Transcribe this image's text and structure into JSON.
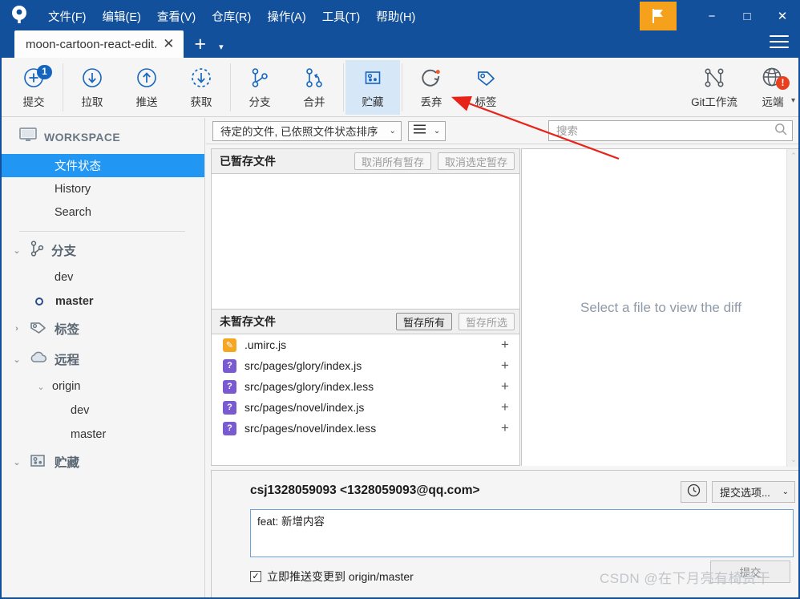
{
  "window": {
    "menus": [
      "文件(F)",
      "编辑(E)",
      "查看(V)",
      "仓库(R)",
      "操作(A)",
      "工具(T)",
      "帮助(H)"
    ],
    "flag_icon": "flag-icon",
    "minimize": "−",
    "maximize": "□",
    "close": "✕",
    "hamburger_icon": "hamburger-icon",
    "accent_blue": "#12509b",
    "flag_orange": "#f5a11b"
  },
  "tabs": {
    "items": [
      {
        "label": "moon-cartoon-react-edit.",
        "close": "✕"
      }
    ],
    "add_label": "+",
    "caret": "▾"
  },
  "toolbar": {
    "items": [
      {
        "label": "提交",
        "icon": "commit-plus-icon",
        "badge": "1",
        "active": false
      },
      {
        "label": "拉取",
        "icon": "pull-down-arrow-icon",
        "badge": null,
        "active": false
      },
      {
        "label": "推送",
        "icon": "push-up-arrow-icon",
        "badge": null,
        "active": false
      },
      {
        "label": "获取",
        "icon": "fetch-dashed-arrow-icon",
        "badge": null,
        "active": false
      },
      {
        "label": "分支",
        "icon": "branch-icon",
        "badge": null,
        "active": false
      },
      {
        "label": "合并",
        "icon": "merge-icon",
        "badge": null,
        "active": false
      },
      {
        "label": "贮藏",
        "icon": "stash-icon",
        "badge": null,
        "active": true
      },
      {
        "label": "丢弃",
        "icon": "discard-reset-icon",
        "badge": null,
        "active": false
      },
      {
        "label": "标签",
        "icon": "tag-icon",
        "badge": null,
        "active": false
      },
      {
        "label": "Git工作流",
        "icon": "gitflow-icon",
        "badge": null,
        "active": false
      },
      {
        "label": "远端",
        "icon": "remote-globe-icon",
        "badge": "!",
        "active": false
      }
    ],
    "overflow": "▾"
  },
  "sidebar": {
    "workspace": {
      "label": "WORKSPACE",
      "icon": "monitor-icon"
    },
    "workspace_items": [
      {
        "label": "文件状态",
        "selected": true
      },
      {
        "label": "History",
        "selected": false
      },
      {
        "label": "Search",
        "selected": false
      }
    ],
    "branches": {
      "label": "分支",
      "icon": "branch-icon",
      "caret": "⌄",
      "items": [
        {
          "label": "dev",
          "current": false
        },
        {
          "label": "master",
          "current": true
        }
      ]
    },
    "tags": {
      "label": "标签",
      "icon": "tag-icon",
      "caret": "›"
    },
    "remotes": {
      "label": "远程",
      "icon": "cloud-icon",
      "caret": "⌄",
      "origin": {
        "label": "origin",
        "caret": "⌄",
        "items": [
          "dev",
          "master"
        ]
      }
    },
    "stashes": {
      "label": "贮藏",
      "icon": "stash-icon",
      "caret": "⌄"
    }
  },
  "filterbar": {
    "sort_value": "待定的文件, 已依照文件状态排序",
    "sort_caret": "⌄",
    "view_icon": "list-view-icon",
    "view_caret": "⌄"
  },
  "search": {
    "placeholder": "搜索",
    "value": "",
    "icon": "search-icon"
  },
  "staged": {
    "title": "已暂存文件",
    "unstage_all_label": "取消所有暂存",
    "unstage_selected_label": "取消选定暂存",
    "files": []
  },
  "unstaged": {
    "title": "未暂存文件",
    "stage_all_label": "暂存所有",
    "stage_selected_label": "暂存所选",
    "files": [
      {
        "name": ".umirc.js",
        "status": "modified",
        "status_glyph": "✎",
        "add": "+"
      },
      {
        "name": "src/pages/glory/index.js",
        "status": "untracked",
        "status_glyph": "?",
        "add": "+"
      },
      {
        "name": "src/pages/glory/index.less",
        "status": "untracked",
        "status_glyph": "?",
        "add": "+"
      },
      {
        "name": "src/pages/novel/index.js",
        "status": "untracked",
        "status_glyph": "?",
        "add": "+"
      },
      {
        "name": "src/pages/novel/index.less",
        "status": "untracked",
        "status_glyph": "?",
        "add": "+"
      }
    ]
  },
  "diff": {
    "empty_message": "Select a file to view the diff",
    "scroll_up": "⌃",
    "scroll_down": "⌄"
  },
  "commit": {
    "author": "csj1328059093 <1328059093@qq.com>",
    "history_icon": "clock-icon",
    "options_label": "提交选项...",
    "options_caret": "⌄",
    "message_value": "feat: 新增内容",
    "push_checkbox_checked": true,
    "push_check_glyph": "✓",
    "push_label": "立即推送变更到 origin/master",
    "commit_button_label": "提交"
  },
  "watermark": {
    "text": "CSDN @在下月亮有椅赍干"
  },
  "annotation": {
    "type": "red-arrow",
    "color": "#e8231a"
  }
}
